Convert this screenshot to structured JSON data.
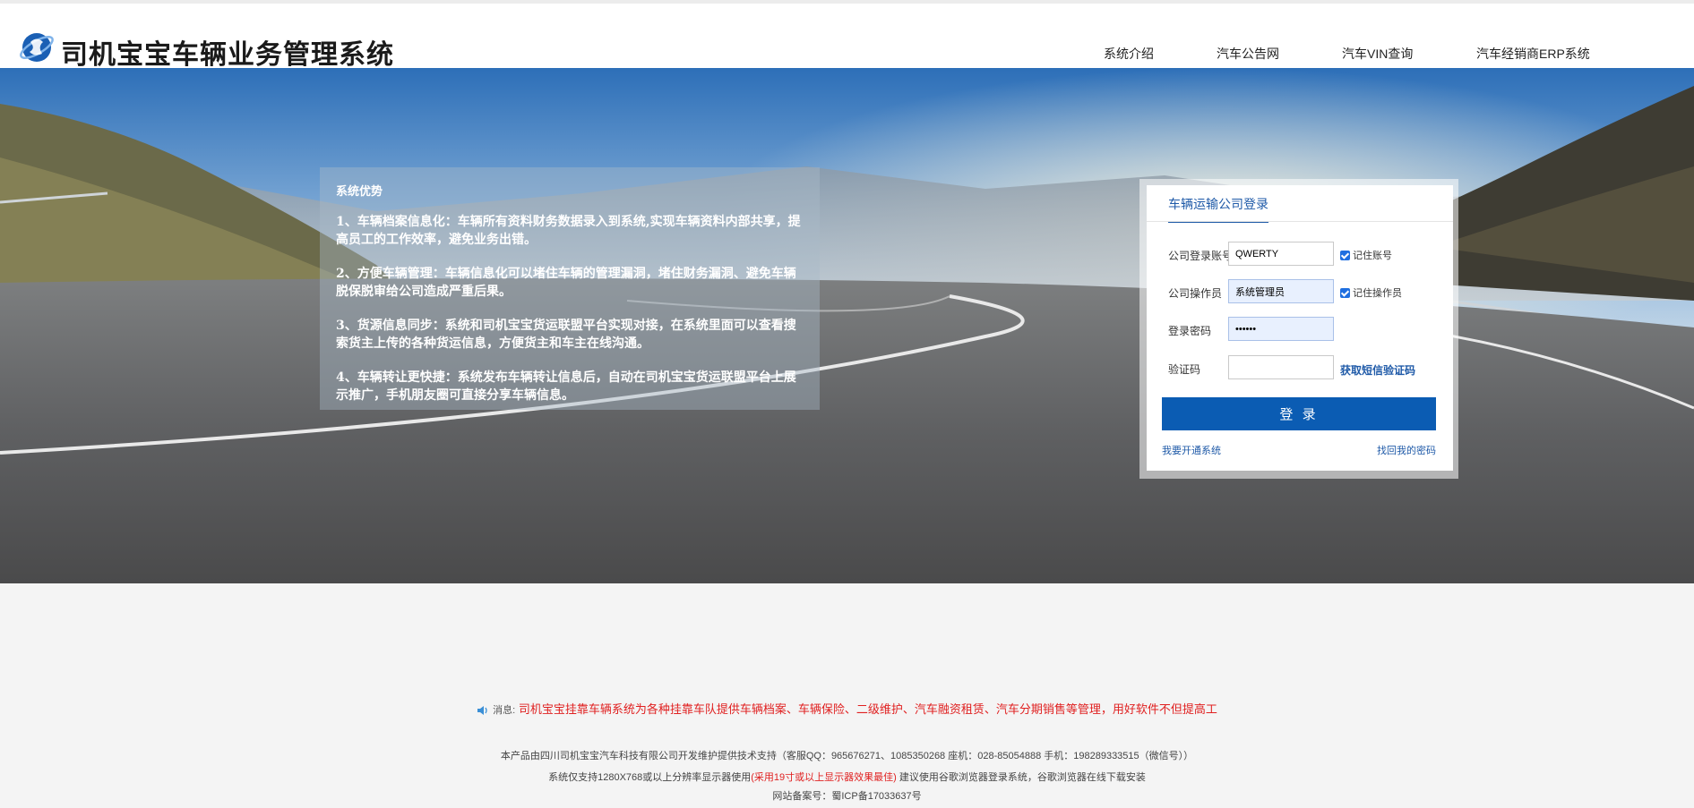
{
  "header": {
    "title": "司机宝宝车辆业务管理系统",
    "nav": [
      {
        "label": "系统介绍"
      },
      {
        "label": "汽车公告网"
      },
      {
        "label": "汽车VIN查询"
      },
      {
        "label": "汽车经销商ERP系统"
      }
    ]
  },
  "advantages": {
    "title": "系统优势",
    "items": [
      "1、车辆档案信息化：车辆所有资料财务数据录入到系统,实现车辆资料内部共享，提高员工的工作效率，避免业务出错。",
      "2、方便车辆管理：车辆信息化可以堵住车辆的管理漏洞，堵住财务漏洞、避免车辆脱保脱审给公司造成严重后果。",
      "3、货源信息同步：系统和司机宝宝货运联盟平台实现对接，在系统里面可以查看搜索货主上传的各种货运信息，方便货主和车主在线沟通。",
      "4、车辆转让更快捷：系统发布车辆转让信息后，自动在司机宝宝货运联盟平台上展示推广，手机朋友圈可直接分享车辆信息。"
    ]
  },
  "login": {
    "tab": "车辆运输公司登录",
    "account_label": "公司登录账号",
    "account_value": "QWERTY",
    "remember_account": "记住账号",
    "operator_label": "公司操作员",
    "operator_value": "系统管理员",
    "remember_operator": "记住操作员",
    "password_label": "登录密码",
    "password_value": "••••••",
    "captcha_label": "验证码",
    "captcha_value": "",
    "sms_link": "获取短信验证码",
    "submit": "登 录",
    "open_system": "我要开通系统",
    "recover_password": "找回我的密码"
  },
  "footer": {
    "notice_label": "消息:",
    "notice_text": "司机宝宝挂靠车辆系统为各种挂靠车队提供车辆档案、车辆保险、二级维护、汽车融资租赁、汽车分期销售等管理，用好软件不但提高工",
    "line1": "本产品由四川司机宝宝汽车科技有限公司开发维护提供技术支持（客服QQ：965676271、1085350268   座机：028-85054888   手机：198289333515（微信号））",
    "line2_a": "系统仅支持1280X768或以上分辨率显示器使用",
    "line2_red": "(采用19寸或以上显示器效果最佳)",
    "line2_b": "   建议使用谷歌浏览器登录系统，谷歌浏览器在线下载安装",
    "line3": "网站备案号：蜀ICP备17033637号"
  },
  "colors": {
    "primary": "#0b5cb3",
    "link": "#1f5aa8",
    "notice": "#e02020"
  }
}
